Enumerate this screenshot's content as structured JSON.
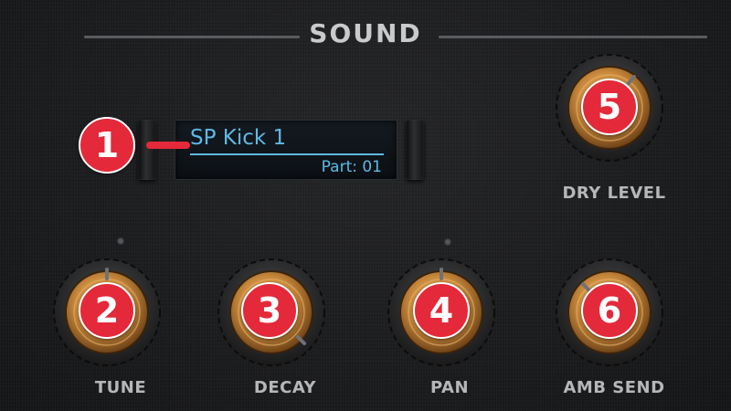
{
  "section": {
    "title": "SOUND"
  },
  "display": {
    "sample_name": "SP Kick 1",
    "part": "Part: 01"
  },
  "knobs": [
    {
      "id": "tune",
      "label": "TUNE",
      "badge": "2"
    },
    {
      "id": "decay",
      "label": "DECAY",
      "badge": "3"
    },
    {
      "id": "pan",
      "label": "PAN",
      "badge": "4"
    },
    {
      "id": "amb_send",
      "label": "AMB SEND",
      "badge": "6"
    },
    {
      "id": "dry_level",
      "label": "DRY LEVEL",
      "badge": "5"
    }
  ],
  "annotations": {
    "display_badge": "1"
  },
  "colors": {
    "badge": "#e4293a",
    "display_text": "#5fb8e3",
    "knob_gold": "#c98a3c"
  },
  "icons": [
    "knob-icon",
    "paddle-button",
    "led-indicator"
  ]
}
